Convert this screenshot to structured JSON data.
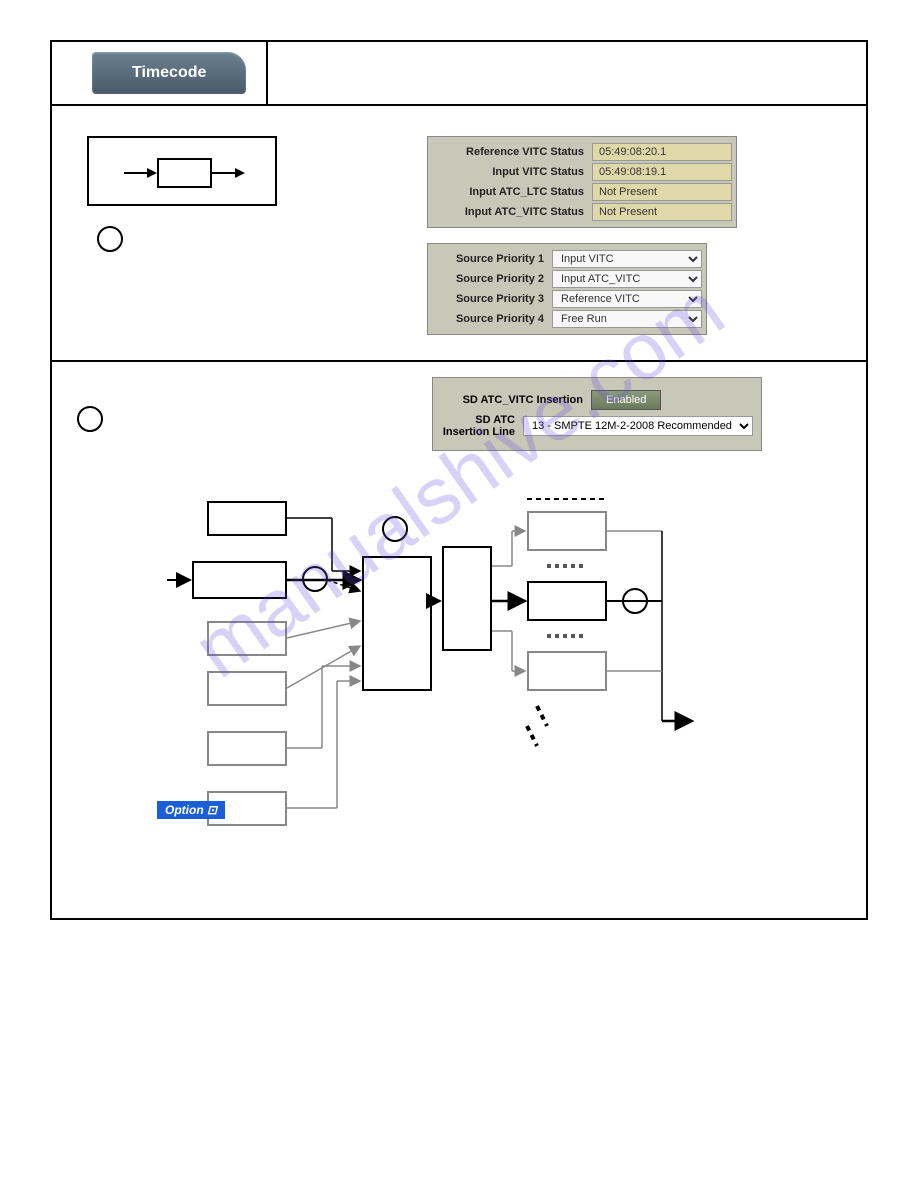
{
  "tab": {
    "title": "Timecode"
  },
  "status": {
    "label_ref_vitc": "Reference VITC Status",
    "value_ref_vitc": "05:49:08:20.1",
    "label_input_vitc": "Input VITC Status",
    "value_input_vitc": "05:49:08:19.1",
    "label_atc_ltc": "Input ATC_LTC Status",
    "value_atc_ltc": "Not Present",
    "label_atc_vitc": "Input ATC_VITC Status",
    "value_atc_vitc": "Not Present"
  },
  "priority": {
    "label1": "Source Priority 1",
    "value1": "Input VITC",
    "label2": "Source Priority 2",
    "value2": "Input ATC_VITC",
    "label3": "Source Priority 3",
    "value3": "Reference VITC",
    "label4": "Source Priority 4",
    "value4": "Free Run"
  },
  "insertion": {
    "label_atc_vitc": "SD ATC_VITC Insertion",
    "btn_enabled": "Enabled",
    "label_line": "SD ATC Insertion Line",
    "value_line": "13 - SMPTE 12M-2-2008 Recommended"
  },
  "option": {
    "label": "Option ⊡"
  },
  "watermark": "manualshive.com"
}
